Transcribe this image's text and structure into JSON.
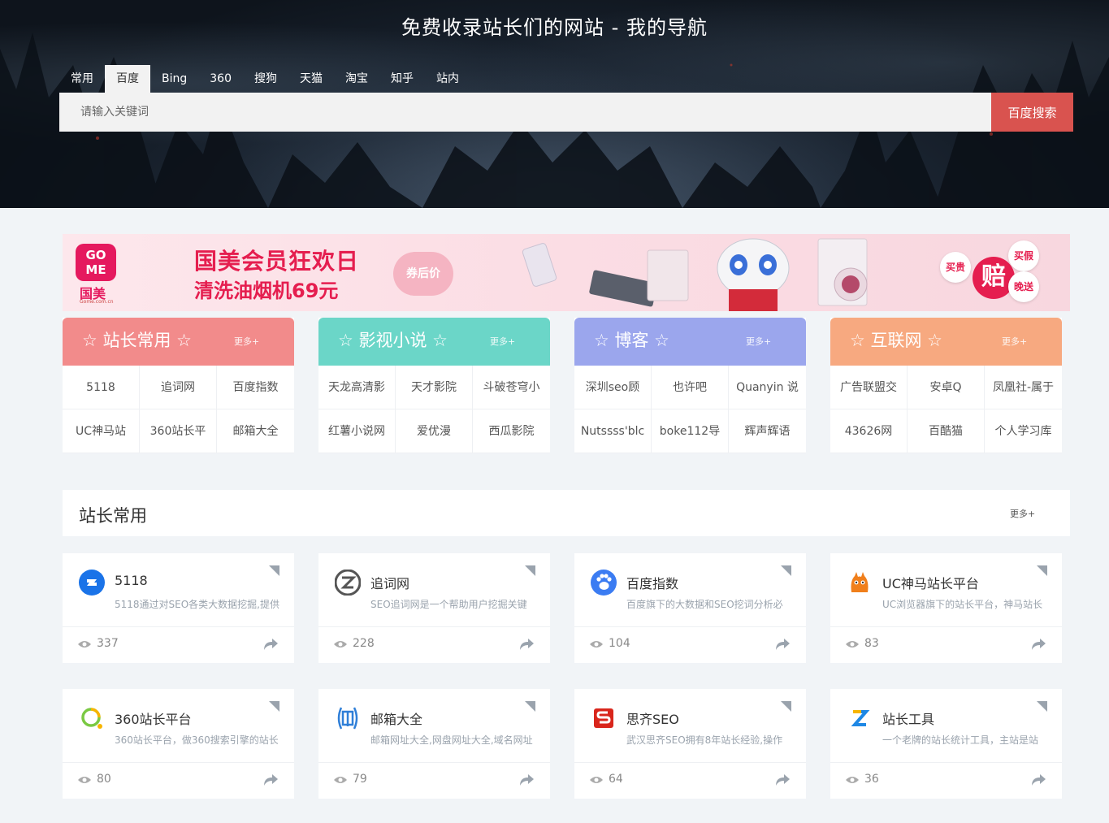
{
  "header": {
    "title": "免费收录站长们的网站 - 我的导航",
    "tabs": [
      "常用",
      "百度",
      "Bing",
      "360",
      "搜狗",
      "天猫",
      "淘宝",
      "知乎",
      "站内"
    ],
    "active_tab": "百度",
    "search_placeholder": "请输入关键词",
    "search_button": "百度搜索",
    "accent_color": "#d9534f"
  },
  "banner": {
    "logo_text": "GO ME",
    "logo_cn": "国美",
    "logo_sub": "Gome.com.cn",
    "line1": "国美会员狂欢日",
    "line2": "清洗油烟机69元",
    "tag": "券后价",
    "badge_main": "赔",
    "badge_left": "买贵",
    "badge_top": "买假",
    "badge_bottom": "晚送"
  },
  "categories": [
    {
      "title": "☆ 站长常用 ☆",
      "more": "更多+",
      "color": "#f28b8b",
      "items": [
        "5118",
        "追词网",
        "百度指数",
        "UC神马站",
        "360站长平",
        "邮箱大全"
      ]
    },
    {
      "title": "☆ 影视小说 ☆",
      "more": "更多+",
      "color": "#6bd6c8",
      "items": [
        "天龙高清影",
        "天才影院",
        "斗破苍穹小",
        "红薯小说网",
        "爱优漫",
        "西瓜影院"
      ]
    },
    {
      "title": "☆ 博客 ☆",
      "more": "更多+",
      "color": "#9ba6ed",
      "items": [
        "深圳seo顾",
        "也许吧",
        "Quanyin 说",
        "Nutssss'blc",
        "boke112导",
        "辉声辉语"
      ]
    },
    {
      "title": "☆ 互联网 ☆",
      "more": "更多+",
      "color": "#f7a980",
      "items": [
        "广告联盟交",
        "安卓Q",
        "凤凰社-属于",
        "43626网",
        "百酷猫",
        "个人学习库"
      ]
    }
  ],
  "section": {
    "title": "站长常用",
    "more": "更多+"
  },
  "sites": [
    {
      "name": "5118",
      "desc": "5118通过对SEO各类大数据挖掘,提供",
      "views": "337",
      "icon": "5118-icon"
    },
    {
      "name": "追词网",
      "desc": "SEO追词网是一个帮助用户挖掘关键",
      "views": "228",
      "icon": "zhuici-icon"
    },
    {
      "name": "百度指数",
      "desc": "百度旗下的大数据和SEO挖词分析必",
      "views": "104",
      "icon": "baidu-paw-icon"
    },
    {
      "name": "UC神马站长平台",
      "desc": "UC浏览器旗下的站长平台，神马站长",
      "views": "83",
      "icon": "uc-squirrel-icon"
    },
    {
      "name": "360站长平台",
      "desc": "360站长平台，做360搜索引擎的站长",
      "views": "80",
      "icon": "360-icon"
    },
    {
      "name": "邮箱大全",
      "desc": "邮箱网址大全,网盘网址大全,域名网址",
      "views": "79",
      "icon": "mail-icon"
    },
    {
      "name": "思齐SEO",
      "desc": "武汉思齐SEO拥有8年站长经验,操作",
      "views": "64",
      "icon": "siqi-icon"
    },
    {
      "name": "站长工具",
      "desc": "一个老牌的站长统计工具，主站是站",
      "views": "36",
      "icon": "zhanzhang-icon"
    }
  ]
}
